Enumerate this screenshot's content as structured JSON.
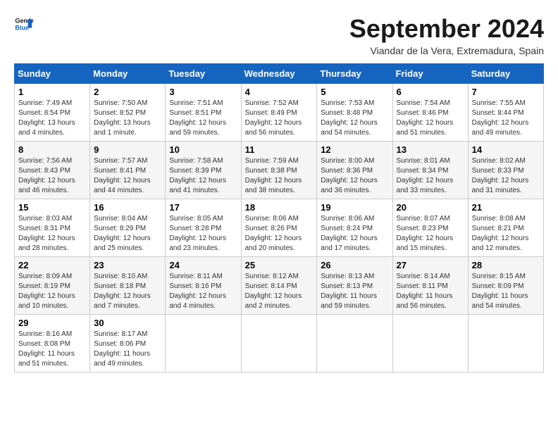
{
  "header": {
    "logo_line1": "General",
    "logo_line2": "Blue",
    "month_title": "September 2024",
    "location": "Viandar de la Vera, Extremadura, Spain"
  },
  "days_of_week": [
    "Sunday",
    "Monday",
    "Tuesday",
    "Wednesday",
    "Thursday",
    "Friday",
    "Saturday"
  ],
  "weeks": [
    [
      {
        "day": "1",
        "sunrise": "7:49 AM",
        "sunset": "8:54 PM",
        "daylight": "13 hours and 4 minutes."
      },
      {
        "day": "2",
        "sunrise": "7:50 AM",
        "sunset": "8:52 PM",
        "daylight": "13 hours and 1 minute."
      },
      {
        "day": "3",
        "sunrise": "7:51 AM",
        "sunset": "8:51 PM",
        "daylight": "12 hours and 59 minutes."
      },
      {
        "day": "4",
        "sunrise": "7:52 AM",
        "sunset": "8:49 PM",
        "daylight": "12 hours and 56 minutes."
      },
      {
        "day": "5",
        "sunrise": "7:53 AM",
        "sunset": "8:48 PM",
        "daylight": "12 hours and 54 minutes."
      },
      {
        "day": "6",
        "sunrise": "7:54 AM",
        "sunset": "8:46 PM",
        "daylight": "12 hours and 51 minutes."
      },
      {
        "day": "7",
        "sunrise": "7:55 AM",
        "sunset": "8:44 PM",
        "daylight": "12 hours and 49 minutes."
      }
    ],
    [
      {
        "day": "8",
        "sunrise": "7:56 AM",
        "sunset": "8:43 PM",
        "daylight": "12 hours and 46 minutes."
      },
      {
        "day": "9",
        "sunrise": "7:57 AM",
        "sunset": "8:41 PM",
        "daylight": "12 hours and 44 minutes."
      },
      {
        "day": "10",
        "sunrise": "7:58 AM",
        "sunset": "8:39 PM",
        "daylight": "12 hours and 41 minutes."
      },
      {
        "day": "11",
        "sunrise": "7:59 AM",
        "sunset": "8:38 PM",
        "daylight": "12 hours and 38 minutes."
      },
      {
        "day": "12",
        "sunrise": "8:00 AM",
        "sunset": "8:36 PM",
        "daylight": "12 hours and 36 minutes."
      },
      {
        "day": "13",
        "sunrise": "8:01 AM",
        "sunset": "8:34 PM",
        "daylight": "12 hours and 33 minutes."
      },
      {
        "day": "14",
        "sunrise": "8:02 AM",
        "sunset": "8:33 PM",
        "daylight": "12 hours and 31 minutes."
      }
    ],
    [
      {
        "day": "15",
        "sunrise": "8:03 AM",
        "sunset": "8:31 PM",
        "daylight": "12 hours and 28 minutes."
      },
      {
        "day": "16",
        "sunrise": "8:04 AM",
        "sunset": "8:29 PM",
        "daylight": "12 hours and 25 minutes."
      },
      {
        "day": "17",
        "sunrise": "8:05 AM",
        "sunset": "8:28 PM",
        "daylight": "12 hours and 23 minutes."
      },
      {
        "day": "18",
        "sunrise": "8:06 AM",
        "sunset": "8:26 PM",
        "daylight": "12 hours and 20 minutes."
      },
      {
        "day": "19",
        "sunrise": "8:06 AM",
        "sunset": "8:24 PM",
        "daylight": "12 hours and 17 minutes."
      },
      {
        "day": "20",
        "sunrise": "8:07 AM",
        "sunset": "8:23 PM",
        "daylight": "12 hours and 15 minutes."
      },
      {
        "day": "21",
        "sunrise": "8:08 AM",
        "sunset": "8:21 PM",
        "daylight": "12 hours and 12 minutes."
      }
    ],
    [
      {
        "day": "22",
        "sunrise": "8:09 AM",
        "sunset": "8:19 PM",
        "daylight": "12 hours and 10 minutes."
      },
      {
        "day": "23",
        "sunrise": "8:10 AM",
        "sunset": "8:18 PM",
        "daylight": "12 hours and 7 minutes."
      },
      {
        "day": "24",
        "sunrise": "8:11 AM",
        "sunset": "8:16 PM",
        "daylight": "12 hours and 4 minutes."
      },
      {
        "day": "25",
        "sunrise": "8:12 AM",
        "sunset": "8:14 PM",
        "daylight": "12 hours and 2 minutes."
      },
      {
        "day": "26",
        "sunrise": "8:13 AM",
        "sunset": "8:13 PM",
        "daylight": "11 hours and 59 minutes."
      },
      {
        "day": "27",
        "sunrise": "8:14 AM",
        "sunset": "8:11 PM",
        "daylight": "11 hours and 56 minutes."
      },
      {
        "day": "28",
        "sunrise": "8:15 AM",
        "sunset": "8:09 PM",
        "daylight": "11 hours and 54 minutes."
      }
    ],
    [
      {
        "day": "29",
        "sunrise": "8:16 AM",
        "sunset": "8:08 PM",
        "daylight": "11 hours and 51 minutes."
      },
      {
        "day": "30",
        "sunrise": "8:17 AM",
        "sunset": "8:06 PM",
        "daylight": "11 hours and 49 minutes."
      },
      null,
      null,
      null,
      null,
      null
    ]
  ],
  "labels": {
    "sunrise": "Sunrise:",
    "sunset": "Sunset:",
    "daylight": "Daylight:"
  }
}
